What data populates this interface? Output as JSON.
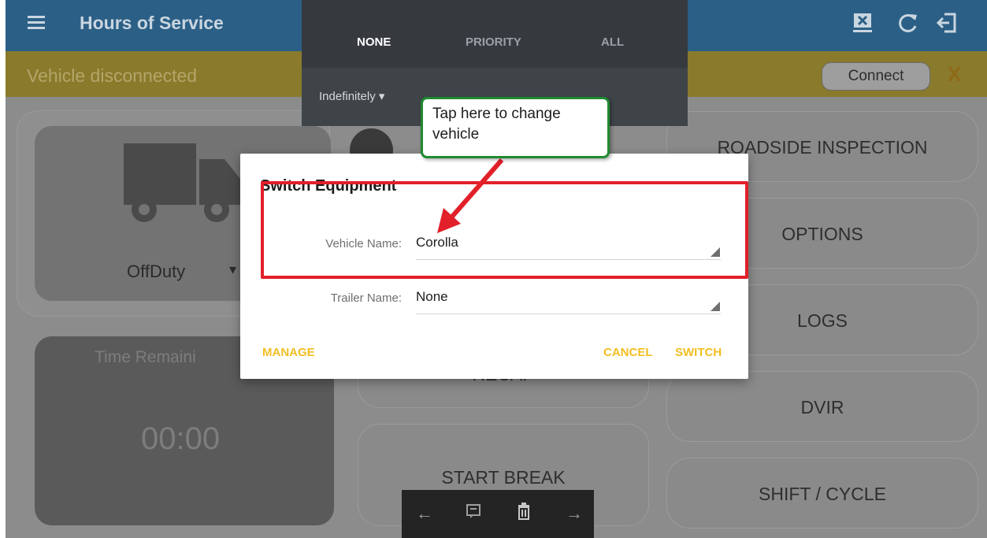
{
  "appbar": {
    "title": "Hours of Service",
    "icons": [
      "menu-icon",
      "disconnect-device-icon",
      "refresh-icon",
      "logout-icon"
    ]
  },
  "banner": {
    "text": "Vehicle disconnected",
    "connect_label": "Connect",
    "close_label": "X"
  },
  "status": {
    "duty_status": "OffDuty",
    "time_remaining_label": "Time Remaini",
    "time_value": "00:00"
  },
  "middle": {
    "recap_label": "RECAP",
    "start_break_label": "START BREAK"
  },
  "menu": {
    "items": [
      "ROADSIDE INSPECTION",
      "OPTIONS",
      "LOGS",
      "DVIR",
      "SHIFT / CYCLE"
    ]
  },
  "shade": {
    "tabs": [
      "NONE",
      "PRIORITY",
      "ALL"
    ],
    "active_tab": "NONE",
    "duration": "Indefinitely"
  },
  "dialog": {
    "title": "Switch Equipment",
    "vehicle_label": "Vehicle Name:",
    "vehicle_value": "Corolla",
    "trailer_label": "Trailer Name:",
    "trailer_value": "None",
    "manage_label": "MANAGE",
    "cancel_label": "CANCEL",
    "switch_label": "SWITCH"
  },
  "annotation": {
    "callout_text": "Tap here to change vehicle",
    "box_color": "#e1202a",
    "callout_border_color": "#1f8a2f"
  },
  "colors": {
    "appbar": "#2b5f86",
    "banner": "#8a7a2c",
    "accent": "#f2be22"
  }
}
